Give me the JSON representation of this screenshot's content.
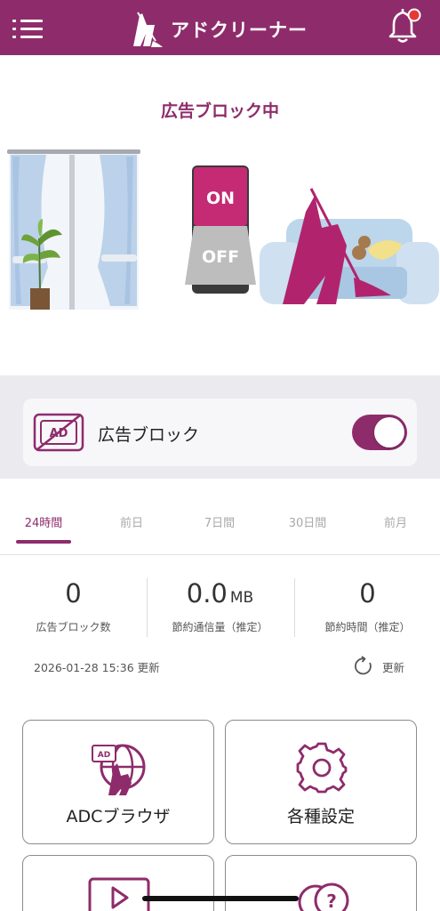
{
  "header": {
    "menu_icon": "hamburger-menu-icon",
    "app_name": "アドクリーナー",
    "notification_icon": "bell-icon",
    "notification_badge_color": "#e53935"
  },
  "brand": {
    "primary_color": "#8e2c6b"
  },
  "status": {
    "title": "広告ブロック中",
    "switch_on_label": "ON",
    "switch_off_label": "OFF"
  },
  "ad_block": {
    "icon_text": "AD",
    "label": "広告ブロック",
    "enabled": true
  },
  "tabs": [
    {
      "label": "24時間",
      "active": true
    },
    {
      "label": "前日",
      "active": false
    },
    {
      "label": "7日間",
      "active": false
    },
    {
      "label": "30日間",
      "active": false
    },
    {
      "label": "前月",
      "active": false
    }
  ],
  "stats": [
    {
      "value": "0",
      "unit": "",
      "label": "広告ブロック数"
    },
    {
      "value": "0.0",
      "unit": "MB",
      "label": "節約通信量（推定）"
    },
    {
      "value": "0",
      "unit": "",
      "label": "節約時間（推定）"
    }
  ],
  "updated_at": "2026-01-28 15:36 更新",
  "refresh_label": "更新",
  "cards": [
    {
      "label": "ADCブラウザ",
      "icon": "adc-browser-icon",
      "icon_text": "AD"
    },
    {
      "label": "各種設定",
      "icon": "settings-gear-icon"
    },
    {
      "label": "",
      "icon": "video-play-icon"
    },
    {
      "label": "",
      "icon": "help-question-icon"
    }
  ]
}
